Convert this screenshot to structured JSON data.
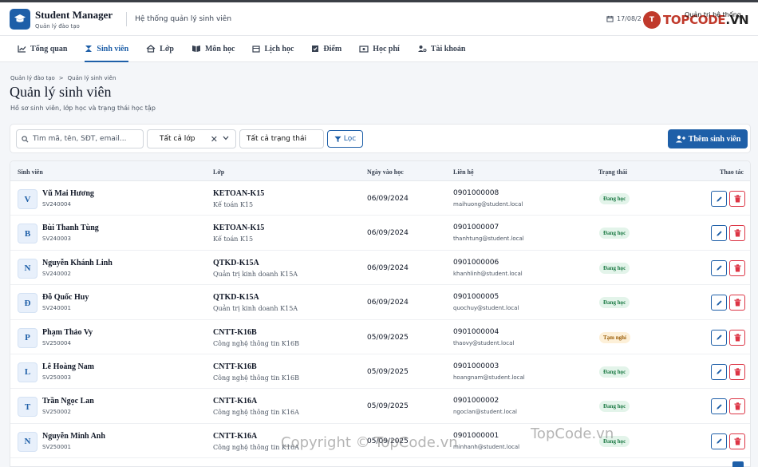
{
  "app": {
    "title": "Student Manager",
    "subtitle": "Quản lý đào tạo",
    "system_name": "Hệ thống quản lý sinh viên",
    "date": "17/08/2",
    "user_role": "Quản trị hệ thống",
    "watermark_logo": "TOPCODE.VN",
    "accent": "#1e5fa8"
  },
  "nav": [
    {
      "label": "Tổng quan",
      "icon": "chart-line-icon"
    },
    {
      "label": "Sinh viên",
      "icon": "graduation-cap-icon"
    },
    {
      "label": "Lớp",
      "icon": "school-icon"
    },
    {
      "label": "Môn học",
      "icon": "book-open-icon"
    },
    {
      "label": "Lịch học",
      "icon": "calendar-icon"
    },
    {
      "label": "Điểm",
      "icon": "grade-icon"
    },
    {
      "label": "Học phí",
      "icon": "money-icon"
    },
    {
      "label": "Tài khoản",
      "icon": "user-cog-icon"
    }
  ],
  "breadcrumb": {
    "root": "Quản lý đào tạo",
    "sep": ">",
    "current": "Quản lý sinh viên"
  },
  "page": {
    "title": "Quản lý sinh viên",
    "subtitle": "Hồ sơ sinh viên, lớp học và trạng thái học tập"
  },
  "filters": {
    "search_placeholder": "Tìm mã, tên, SĐT, email...",
    "class_select": "Tất cả lớp",
    "status_select": "Tất cả trạng thái",
    "filter_button": "Lọc",
    "add_button": "Thêm sinh viên"
  },
  "table": {
    "headers": {
      "student": "Sinh viên",
      "class": "Lớp",
      "enrolled": "Ngày vào học",
      "contact": "Liên hệ",
      "status": "Trạng thái",
      "actions": "Thao tác"
    },
    "rows": [
      {
        "initial": "V",
        "name": "Vũ Mai Hương",
        "code": "SV240004",
        "class_code": "KETOAN-K15",
        "class_name": "Kế toán K15",
        "date": "06/09/2024",
        "phone": "0901000008",
        "email": "maihuong@student.local",
        "status": "Đang học",
        "status_kind": "ok"
      },
      {
        "initial": "B",
        "name": "Bùi Thanh Tùng",
        "code": "SV240003",
        "class_code": "KETOAN-K15",
        "class_name": "Kế toán K15",
        "date": "06/09/2024",
        "phone": "0901000007",
        "email": "thanhtung@student.local",
        "status": "Đang học",
        "status_kind": "ok"
      },
      {
        "initial": "N",
        "name": "Nguyễn Khánh Linh",
        "code": "SV240002",
        "class_code": "QTKD-K15A",
        "class_name": "Quản trị kinh doanh K15A",
        "date": "06/09/2024",
        "phone": "0901000006",
        "email": "khanhlinh@student.local",
        "status": "Đang học",
        "status_kind": "ok"
      },
      {
        "initial": "Đ",
        "name": "Đỗ Quốc Huy",
        "code": "SV240001",
        "class_code": "QTKD-K15A",
        "class_name": "Quản trị kinh doanh K15A",
        "date": "06/09/2024",
        "phone": "0901000005",
        "email": "quochuy@student.local",
        "status": "Đang học",
        "status_kind": "ok"
      },
      {
        "initial": "P",
        "name": "Phạm Thảo Vy",
        "code": "SV250004",
        "class_code": "CNTT-K16B",
        "class_name": "Công nghệ thông tin K16B",
        "date": "05/09/2025",
        "phone": "0901000004",
        "email": "thaovy@student.local",
        "status": "Tạm nghỉ",
        "status_kind": "pause"
      },
      {
        "initial": "L",
        "name": "Lê Hoàng Nam",
        "code": "SV250003",
        "class_code": "CNTT-K16B",
        "class_name": "Công nghệ thông tin K16B",
        "date": "05/09/2025",
        "phone": "0901000003",
        "email": "hoangnam@student.local",
        "status": "Đang học",
        "status_kind": "ok"
      },
      {
        "initial": "T",
        "name": "Trần Ngọc Lan",
        "code": "SV250002",
        "class_code": "CNTT-K16A",
        "class_name": "Công nghệ thông tin K16A",
        "date": "05/09/2025",
        "phone": "0901000002",
        "email": "ngoclan@student.local",
        "status": "Đang học",
        "status_kind": "ok"
      },
      {
        "initial": "N",
        "name": "Nguyễn Minh Anh",
        "code": "SV250001",
        "class_code": "CNTT-K16A",
        "class_name": "Công nghệ thông tin K16A",
        "date": "05/09/2025",
        "phone": "0901000001",
        "email": "minhanh@student.local",
        "status": "Đang học",
        "status_kind": "ok"
      }
    ]
  },
  "watermark": {
    "copyright": "Copyright © TopCode.vn",
    "site": "TopCode.vn"
  }
}
